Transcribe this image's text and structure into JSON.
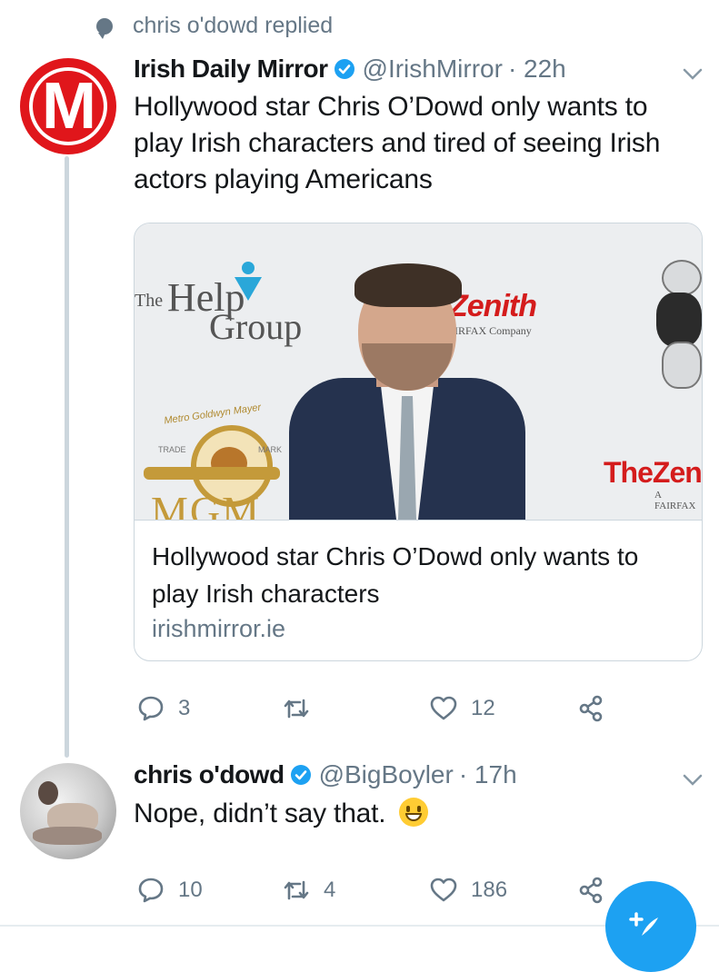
{
  "context": {
    "text": "chris o'dowd replied"
  },
  "tweet1": {
    "name": "Irish Daily Mirror",
    "handle": "@IrishMirror",
    "time": "· 22h",
    "avatar_letter": "M",
    "text": "Hollywood star Chris O’Dowd only wants to play Irish characters and tired of seeing Irish actors playing Americans",
    "card": {
      "title": "Hollywood star Chris O’Dowd only wants to play Irish characters",
      "domain": "irishmirror.ie",
      "backdrop": {
        "help_the": "The",
        "help_word": "Help",
        "help_group": "Group",
        "zenith": "Zenith",
        "zenith_sub": "IRFAX Company",
        "mgm_arc": "Metro Goldwyn Mayer",
        "trade": "TRADE",
        "mark": "MARK",
        "mgm": "MGM",
        "thezen": "TheZen",
        "fairfax": "A FAIRFAX"
      }
    },
    "actions": {
      "replies": "3",
      "retweets": "",
      "likes": "12"
    }
  },
  "tweet2": {
    "name": "chris o'dowd",
    "handle": "@BigBoyler",
    "time": "· 17h",
    "text": "Nope, didn’t say that.",
    "emoji": "😀",
    "actions": {
      "replies": "10",
      "retweets": "4",
      "likes": "186"
    }
  },
  "icons": {
    "verified": "verified-badge-icon",
    "reply": "reply-icon",
    "retweet": "retweet-icon",
    "like": "heart-icon",
    "share": "share-icon",
    "caret": "chevron-down-icon",
    "compose": "compose-tweet-icon"
  },
  "colors": {
    "twitter_blue": "#1da1f2",
    "mirror_red": "#e0161b",
    "meta_gray": "#657786"
  }
}
